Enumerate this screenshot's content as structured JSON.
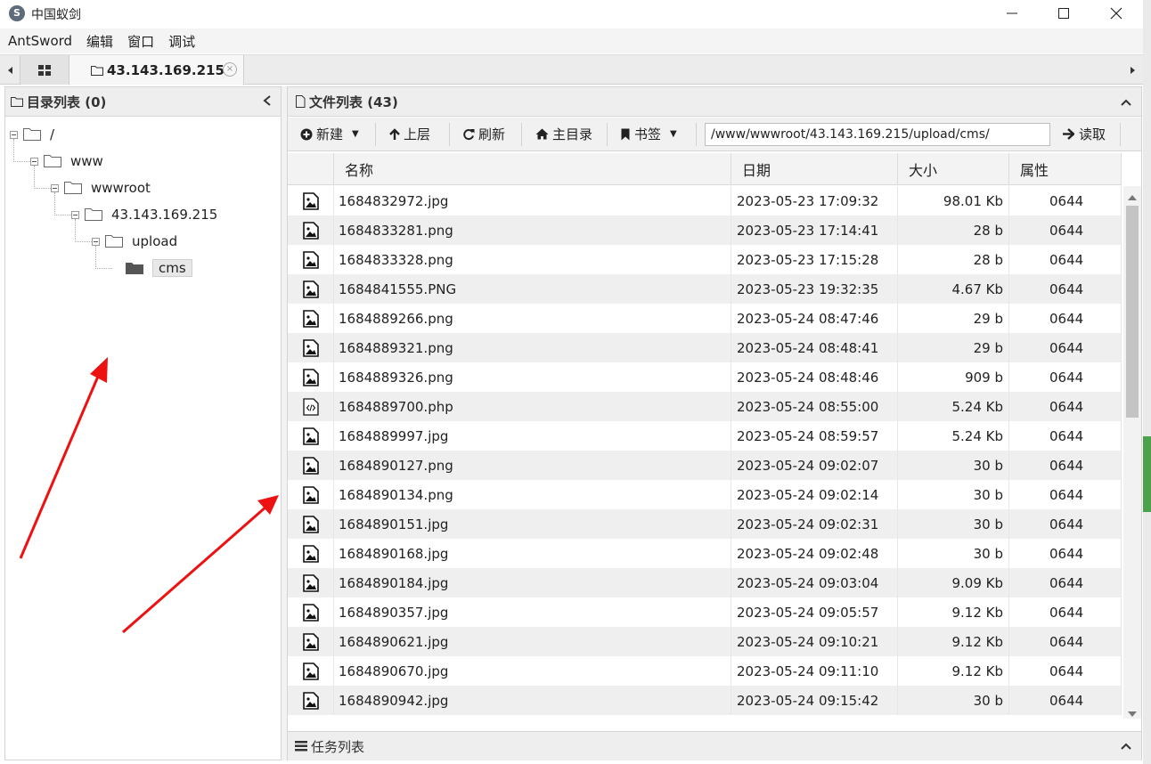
{
  "window": {
    "title": "中国蚁剑",
    "logo_glyph": "S"
  },
  "menu": [
    "AntSword",
    "编辑",
    "窗口",
    "调试"
  ],
  "tabs": {
    "host_label": "43.143.169.215",
    "close_glyph": "×"
  },
  "left_panel": {
    "title": "目录列表 (0)",
    "tree": [
      {
        "label": "/",
        "depth": 0,
        "open": true
      },
      {
        "label": "www",
        "depth": 1,
        "open": true
      },
      {
        "label": "wwwroot",
        "depth": 2,
        "open": true
      },
      {
        "label": "43.143.169.215",
        "depth": 3,
        "open": true
      },
      {
        "label": "upload",
        "depth": 4,
        "open": true
      },
      {
        "label": "cms",
        "depth": 5,
        "open": false,
        "selected": true
      }
    ]
  },
  "right_panel": {
    "title": "文件列表 (43)",
    "toolbar": {
      "new_label": "新建",
      "up_label": "上层",
      "refresh_label": "刷新",
      "home_label": "主目录",
      "bookmark_label": "书签",
      "path_value": "/www/wwwroot/43.143.169.215/upload/cms/",
      "read_label": "读取"
    },
    "columns": {
      "name": "名称",
      "date": "日期",
      "size": "大小",
      "perm": "属性"
    },
    "files": [
      {
        "name": "1684832972.jpg",
        "date": "2023-05-23 17:09:32",
        "size": "98.01 Kb",
        "perm": "0644",
        "type": "image"
      },
      {
        "name": "1684833281.png",
        "date": "2023-05-23 17:14:41",
        "size": "28 b",
        "perm": "0644",
        "type": "image"
      },
      {
        "name": "1684833328.png",
        "date": "2023-05-23 17:15:28",
        "size": "28 b",
        "perm": "0644",
        "type": "image"
      },
      {
        "name": "1684841555.PNG",
        "date": "2023-05-23 19:32:35",
        "size": "4.67 Kb",
        "perm": "0644",
        "type": "image"
      },
      {
        "name": "1684889266.png",
        "date": "2023-05-24 08:47:46",
        "size": "29 b",
        "perm": "0644",
        "type": "image"
      },
      {
        "name": "1684889321.png",
        "date": "2023-05-24 08:48:41",
        "size": "29 b",
        "perm": "0644",
        "type": "image"
      },
      {
        "name": "1684889326.png",
        "date": "2023-05-24 08:48:46",
        "size": "909 b",
        "perm": "0644",
        "type": "image"
      },
      {
        "name": "1684889700.php",
        "date": "2023-05-24 08:55:00",
        "size": "5.24 Kb",
        "perm": "0644",
        "type": "code"
      },
      {
        "name": "1684889997.jpg",
        "date": "2023-05-24 08:59:57",
        "size": "5.24 Kb",
        "perm": "0644",
        "type": "image"
      },
      {
        "name": "1684890127.png",
        "date": "2023-05-24 09:02:07",
        "size": "30 b",
        "perm": "0644",
        "type": "image"
      },
      {
        "name": "1684890134.png",
        "date": "2023-05-24 09:02:14",
        "size": "30 b",
        "perm": "0644",
        "type": "image"
      },
      {
        "name": "1684890151.jpg",
        "date": "2023-05-24 09:02:31",
        "size": "30 b",
        "perm": "0644",
        "type": "image"
      },
      {
        "name": "1684890168.jpg",
        "date": "2023-05-24 09:02:48",
        "size": "30 b",
        "perm": "0644",
        "type": "image"
      },
      {
        "name": "1684890184.jpg",
        "date": "2023-05-24 09:03:04",
        "size": "9.09 Kb",
        "perm": "0644",
        "type": "image"
      },
      {
        "name": "1684890357.jpg",
        "date": "2023-05-24 09:05:57",
        "size": "9.12 Kb",
        "perm": "0644",
        "type": "image"
      },
      {
        "name": "1684890621.jpg",
        "date": "2023-05-24 09:10:21",
        "size": "9.12 Kb",
        "perm": "0644",
        "type": "image"
      },
      {
        "name": "1684890670.jpg",
        "date": "2023-05-24 09:11:10",
        "size": "9.12 Kb",
        "perm": "0644",
        "type": "image"
      },
      {
        "name": "1684890942.jpg",
        "date": "2023-05-24 09:15:42",
        "size": "30 b",
        "perm": "0644",
        "type": "image"
      }
    ]
  },
  "task_panel": {
    "title": "任务列表"
  },
  "colors": {
    "annotation_arrow": "#ee1111",
    "accent_green": "#4ca24c"
  }
}
